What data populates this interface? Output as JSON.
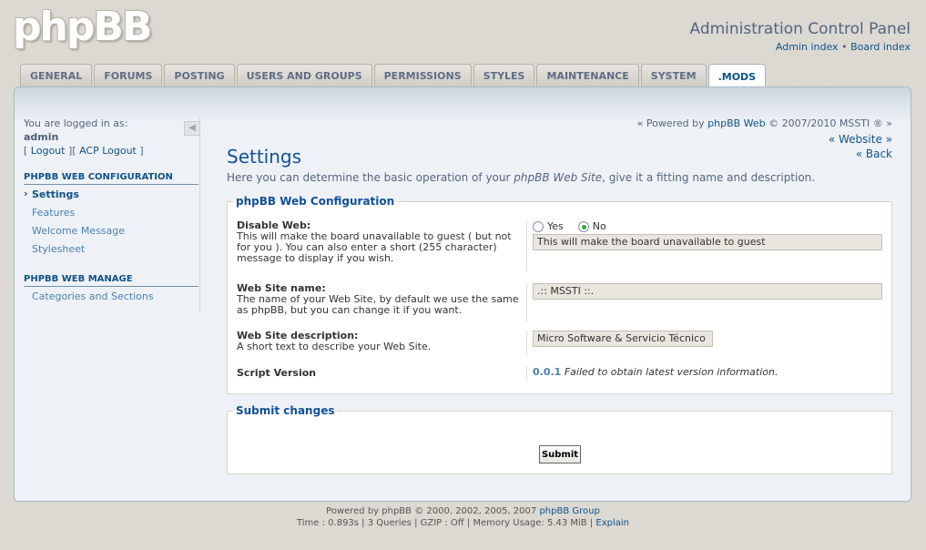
{
  "header": {
    "logo": "phpBB",
    "title": "Administration Control Panel",
    "link_admin_index": "Admin index",
    "separator": "•",
    "link_board_index": "Board index"
  },
  "tabs": [
    {
      "label": "GENERAL"
    },
    {
      "label": "FORUMS"
    },
    {
      "label": "POSTING"
    },
    {
      "label": "USERS AND GROUPS"
    },
    {
      "label": "PERMISSIONS"
    },
    {
      "label": "STYLES"
    },
    {
      "label": "MAINTENANCE"
    },
    {
      "label": "SYSTEM"
    },
    {
      "label": ".MODS"
    }
  ],
  "sidebar": {
    "logged_in_as": "You are logged in as:",
    "username": "admin",
    "bracket_open": "[",
    "logout": "Logout",
    "bracket_mid": "][",
    "acp_logout": "ACP Logout",
    "bracket_close": "]",
    "collapse_glyph": "◀",
    "section1_title": "PHPBB WEB CONFIGURATION",
    "section1_items": [
      "Settings",
      "Features",
      "Welcome Message",
      "Stylesheet"
    ],
    "section2_title": "PHPBB WEB MANAGE",
    "section2_items": [
      "Categories and Sections"
    ]
  },
  "content": {
    "powered_prefix": "« Powered by",
    "powered_link": "phpBB Web",
    "powered_suffix": "© 2007/2010 MSSTI ® »",
    "website_link": "« Website »",
    "back_link": "« Back",
    "page_title": "Settings",
    "desc_prefix": "Here you can determine the basic operation of your",
    "desc_em": "phpBB Web Site",
    "desc_suffix": ", give it a fitting name and description."
  },
  "config": {
    "legend": "phpBB Web Configuration",
    "disable_web": {
      "label": "Disable Web:",
      "explain": "This will make the board unavailable to guest ( but not for you ). You can also enter a short (255 character) message to display if you wish.",
      "yes": "Yes",
      "no": "No",
      "selected": "No",
      "value": "This will make the board unavailable to guest"
    },
    "site_name": {
      "label": "Web Site name:",
      "explain": "The name of your Web Site, by default we use the same as phpBB, but you can change it if you want.",
      "value": ".:: MSSTI ::."
    },
    "site_desc": {
      "label": "Web Site description:",
      "explain": "A short text to describe your Web Site.",
      "value": "Micro Software & Servicio Técnico"
    },
    "script_version": {
      "label": "Script Version",
      "version": "0.0.1",
      "status": "Failed to obtain latest version information."
    }
  },
  "submit": {
    "legend": "Submit changes",
    "button": "Submit"
  },
  "footer": {
    "line1_prefix": "Powered by phpBB © 2000, 2002, 2005, 2007",
    "line1_link": "phpBB Group",
    "line2_prefix": "Time : 0.893s | 3 Queries | GZIP : Off | Memory Usage: 5.43 MiB |",
    "line2_link": "Explain"
  }
}
